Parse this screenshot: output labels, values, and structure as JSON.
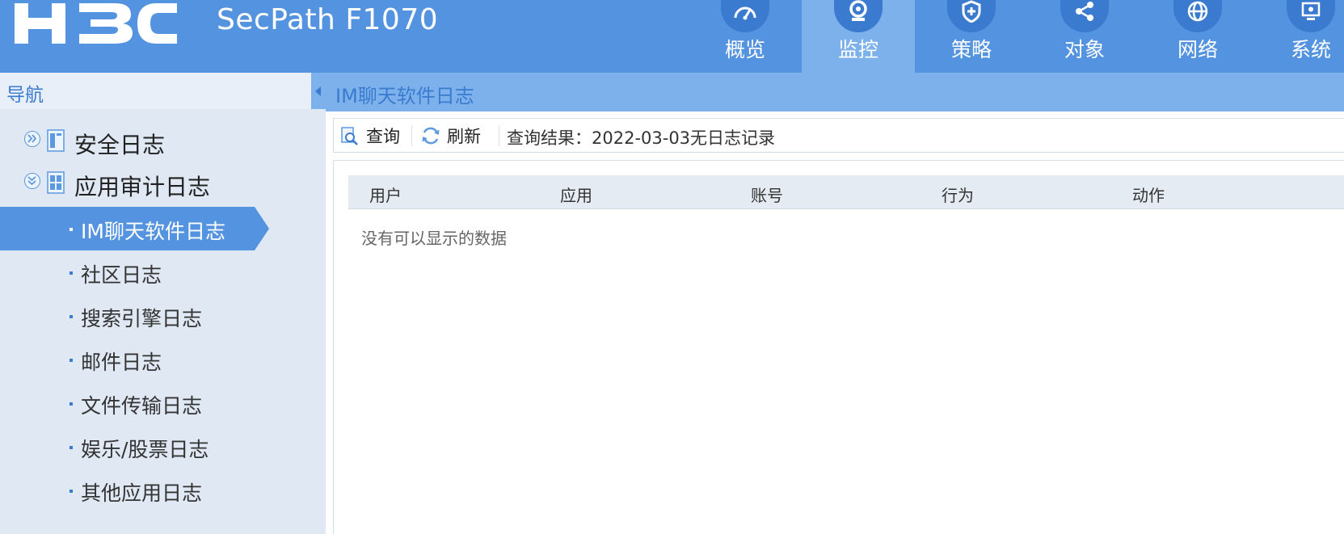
{
  "header": {
    "logo_text": "H3C",
    "product": "SecPath F1070",
    "nav": [
      {
        "label": "概览",
        "icon": "gauge-icon",
        "active": false
      },
      {
        "label": "监控",
        "icon": "camera-icon",
        "active": true
      },
      {
        "label": "策略",
        "icon": "shield-icon",
        "active": false
      },
      {
        "label": "对象",
        "icon": "share-icon",
        "active": false
      },
      {
        "label": "网络",
        "icon": "globe-icon",
        "active": false
      },
      {
        "label": "系统",
        "icon": "monitor-icon",
        "active": false
      }
    ]
  },
  "sidebar": {
    "title": "导航",
    "groups": [
      {
        "label": "安全日志",
        "expanded": false
      },
      {
        "label": "应用审计日志",
        "expanded": true
      }
    ],
    "items": [
      {
        "label": "IM聊天软件日志",
        "active": true
      },
      {
        "label": "社区日志",
        "active": false
      },
      {
        "label": "搜索引擎日志",
        "active": false
      },
      {
        "label": "邮件日志",
        "active": false
      },
      {
        "label": "文件传输日志",
        "active": false
      },
      {
        "label": "娱乐/股票日志",
        "active": false
      },
      {
        "label": "其他应用日志",
        "active": false
      }
    ]
  },
  "main": {
    "title": "IM聊天软件日志",
    "toolbar": {
      "query_label": "查询",
      "refresh_label": "刷新",
      "result_label": "查询结果：",
      "result_value": "2022-03-03无日志记录"
    },
    "table": {
      "columns": [
        "用户",
        "应用",
        "账号",
        "行为",
        "动作"
      ],
      "rows": [],
      "empty_text": "没有可以显示的数据"
    }
  },
  "colors": {
    "header_bg": "#5493df",
    "nav_active_bg": "#7db1ec",
    "accent": "#3a7bd0",
    "sidebar_bg": "#dfe8f3",
    "sidebar_active_bg": "#5493df"
  }
}
